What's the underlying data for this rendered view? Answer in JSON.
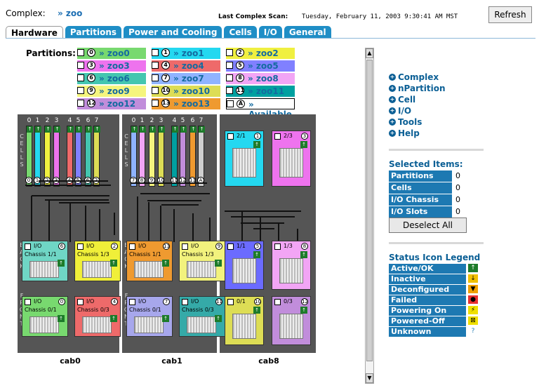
{
  "header": {
    "complex_label": "Complex:",
    "complex_link": "» zoo",
    "scan_label": "Last Complex Scan:",
    "scan_value": "Tuesday, February 11, 2003 9:30:41 AM MST",
    "refresh": "Refresh"
  },
  "tabs": [
    "Hardware",
    "Partitions",
    "Power and Cooling",
    "Cells",
    "I/O",
    "General"
  ],
  "partitions": {
    "title": "Partitions:",
    "items": [
      {
        "num": "0",
        "label": "» zoo0",
        "color": "#78d96f"
      },
      {
        "num": "1",
        "label": "» zoo1",
        "color": "#24d8f0"
      },
      {
        "num": "2",
        "label": "» zoo2",
        "color": "#f0f040"
      },
      {
        "num": "3",
        "label": "» zoo3",
        "color": "#ee73ee"
      },
      {
        "num": "4",
        "label": "» zoo4",
        "color": "#ee6a6a"
      },
      {
        "num": "5",
        "label": "» zoo5",
        "color": "#8080ff"
      },
      {
        "num": "6",
        "label": "» zoo6",
        "color": "#44c6b0"
      },
      {
        "num": "7",
        "label": "» zoo7",
        "color": "#8fb3ff"
      },
      {
        "num": "8",
        "label": "» zoo8",
        "color": "#f2a5f5"
      },
      {
        "num": "9",
        "label": "» zoo9",
        "color": "#f5f57e"
      },
      {
        "num": "10",
        "label": "» zoo10",
        "color": "#dddd55"
      },
      {
        "num": "11",
        "label": "» zoo11",
        "color": "#00a0a0"
      },
      {
        "num": "12",
        "label": "» zoo12",
        "color": "#c18ddb"
      },
      {
        "num": "13",
        "label": "» zoo13",
        "color": "#ef9a30"
      },
      {
        "num": "A",
        "label": "» Available",
        "color": "#ffffff"
      }
    ]
  },
  "cabinets": [
    {
      "name": "cab0",
      "cell_numbers": [
        "0",
        "1",
        "2",
        "3",
        "4",
        "5",
        "6",
        "7"
      ],
      "cell_badges": [
        "0",
        "1",
        "2",
        "3",
        "4",
        "5",
        "6",
        "2"
      ],
      "side_top": "CELLS",
      "side_mid": "BACK",
      "side_bottom": "FRONT",
      "chassis": [
        {
          "io": "I/O",
          "badge": "6",
          "title": "Chassis 1/1",
          "color": "#6fd6c5"
        },
        {
          "io": "I/O",
          "badge": "2",
          "title": "Chassis 1/3",
          "color": "#f0ef39"
        },
        {
          "io": "I/O",
          "badge": "0",
          "title": "Chassis 0/1",
          "color": "#78d96f"
        },
        {
          "io": "I/O",
          "badge": "4",
          "title": "Chassis 0/3",
          "color": "#ee6a6a"
        }
      ]
    },
    {
      "name": "cab1",
      "cell_numbers": [
        "0",
        "1",
        "2",
        "3",
        "4",
        "5",
        "6",
        "7"
      ],
      "cell_badges": [
        "7",
        "8",
        "9",
        "10",
        "11",
        "12",
        "13",
        "A"
      ],
      "side_top": "CELLS",
      "side_mid": "BACK",
      "side_bottom": "FRONT",
      "chassis": [
        {
          "io": "I/O",
          "badge": "13",
          "title": "Chassis 1/1",
          "color": "#ef9a30"
        },
        {
          "io": "I/O",
          "badge": "9",
          "title": "Chassis 1/3",
          "color": "#f2f27d"
        },
        {
          "io": "I/O",
          "badge": "7",
          "title": "Chassis 0/1",
          "color": "#a7a7ec"
        },
        {
          "io": "I/O",
          "badge": "11",
          "title": "Chassis 0/3",
          "color": "#35aaa8"
        }
      ]
    },
    {
      "name": "cab8",
      "top_blocks": [
        {
          "label": "2/1",
          "badge": "1",
          "color": "#24d8f0"
        },
        {
          "label": "2/3",
          "badge": "3",
          "color": "#ee73ee"
        }
      ],
      "bottom_blocks": [
        {
          "label": "1/1",
          "badge": "5",
          "color": "#6b6bff"
        },
        {
          "label": "1/3",
          "badge": "8",
          "color": "#f2a5f5"
        },
        {
          "label": "0/1",
          "badge": "10",
          "color": "#dddd55"
        },
        {
          "label": "0/3",
          "badge": "12",
          "color": "#c18ddb"
        }
      ]
    }
  ],
  "nav": [
    "Complex",
    "nPartition",
    "Cell",
    "I/O",
    "Tools",
    "Help"
  ],
  "selected_items": {
    "title": "Selected Items:",
    "rows": [
      {
        "label": "Partitions",
        "value": "0"
      },
      {
        "label": "Cells",
        "value": "0"
      },
      {
        "label": "I/O Chassis",
        "value": "0"
      },
      {
        "label": "I/O Slots",
        "value": "0"
      }
    ],
    "deselect": "Deselect All"
  },
  "status_legend": {
    "title": "Status Icon Legend",
    "rows": [
      {
        "label": "Active/OK",
        "icon": "↑"
      },
      {
        "label": "Inactive",
        "icon": "↓"
      },
      {
        "label": "Deconfigured",
        "icon": "▼"
      },
      {
        "label": "Failed",
        "icon": "●"
      },
      {
        "label": "Powering On",
        "icon": "⚡"
      },
      {
        "label": "Powered-Off",
        "icon": "⊠"
      },
      {
        "label": "Unknown",
        "icon": "?"
      }
    ]
  }
}
